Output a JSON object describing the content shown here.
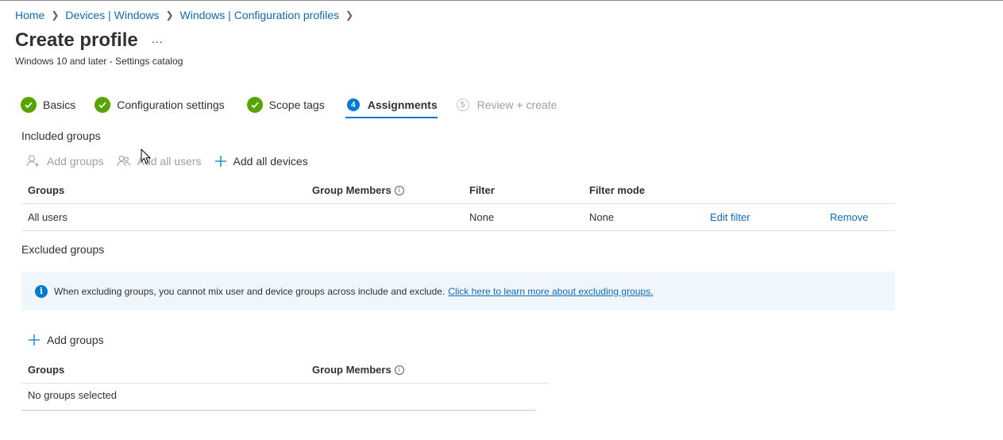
{
  "breadcrumb": [
    "Home",
    "Devices | Windows",
    "Windows | Configuration profiles"
  ],
  "header": {
    "title": "Create profile",
    "more": "...",
    "subtitle": "Windows 10 and later - Settings catalog"
  },
  "steps": [
    {
      "label": "Basics",
      "state": "done"
    },
    {
      "label": "Configuration settings",
      "state": "done"
    },
    {
      "label": "Scope tags",
      "state": "done"
    },
    {
      "label": "Assignments",
      "state": "current",
      "number": "4"
    },
    {
      "label": "Review + create",
      "state": "todo",
      "number": "5"
    }
  ],
  "included": {
    "title": "Included groups",
    "commands": {
      "add_groups": "Add groups",
      "add_all_users": "Add all users",
      "add_all_devices": "Add all devices"
    },
    "columns": {
      "groups": "Groups",
      "members": "Group Members",
      "filter": "Filter",
      "filter_mode": "Filter mode"
    },
    "rows": [
      {
        "group": "All users",
        "filter": "None",
        "filter_mode": "None",
        "edit": "Edit filter",
        "remove": "Remove"
      }
    ]
  },
  "excluded": {
    "title": "Excluded groups",
    "banner_text": "When excluding groups, you cannot mix user and device groups across include and exclude.",
    "banner_link": "Click here to learn more about excluding groups.",
    "add_groups": "Add groups",
    "columns": {
      "groups": "Groups",
      "members": "Group Members"
    },
    "empty": "No groups selected"
  },
  "colors": {
    "accent": "#0078d4",
    "link": "#0f6cbd",
    "success": "#57a300",
    "banner_bg": "#eff6fc"
  }
}
